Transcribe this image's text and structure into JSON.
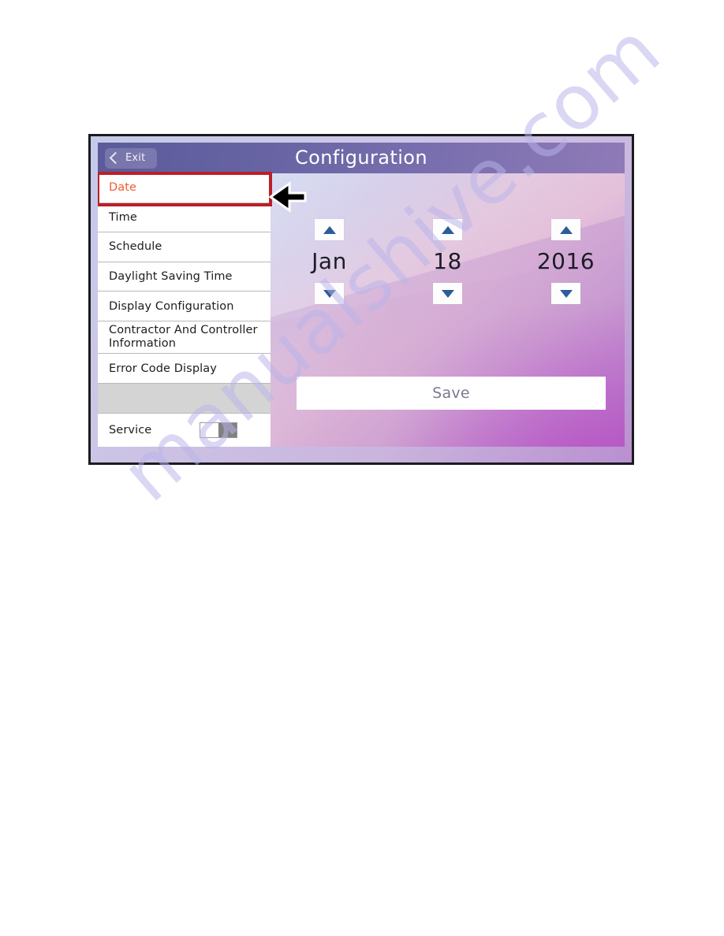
{
  "device_screen": {
    "header": {
      "exit_label": "Exit",
      "back_icon": "chevron-left-icon",
      "title": "Configuration"
    },
    "sidebar": {
      "items": [
        {
          "label": "Date",
          "type": "item",
          "selected": true,
          "lines": 1
        },
        {
          "label": "Time",
          "type": "item",
          "selected": false,
          "lines": 1
        },
        {
          "label": "Schedule",
          "type": "item",
          "selected": false,
          "lines": 1
        },
        {
          "label": "Daylight Saving Time",
          "type": "item",
          "selected": false,
          "lines": 1
        },
        {
          "label": "Display Configuration",
          "type": "item",
          "selected": false,
          "lines": 1
        },
        {
          "label": "Contractor And Controller Information",
          "type": "item",
          "selected": false,
          "lines": 2
        },
        {
          "label": "Error Code Display",
          "type": "item",
          "selected": false,
          "lines": 1
        },
        {
          "label": "",
          "type": "spacer",
          "selected": false,
          "lines": 1
        },
        {
          "label": "Service",
          "type": "toggle",
          "selected": false,
          "lines": 1
        }
      ],
      "service_toggle": {
        "name": "service-toggle",
        "state": "off"
      }
    },
    "content": {
      "date_picker": {
        "fields": [
          {
            "name": "month",
            "value": "Jan",
            "increment_icon": "triangle-up-icon",
            "decrement_icon": "triangle-down-icon"
          },
          {
            "name": "day",
            "value": "18",
            "increment_icon": "triangle-up-icon",
            "decrement_icon": "triangle-down-icon"
          },
          {
            "name": "year",
            "value": "2016",
            "increment_icon": "triangle-up-icon",
            "decrement_icon": "triangle-down-icon"
          }
        ]
      },
      "save_label": "Save"
    }
  },
  "annotations": {
    "pointer_arrow": {
      "name": "pointer-arrow-left",
      "target": "Date"
    },
    "highlight_box": {
      "name": "date-highlight-box",
      "color": "#bb1f28",
      "target": "Date"
    }
  },
  "watermark": {
    "text": "manualshive.com",
    "color": "#b9b4ea"
  },
  "colors": {
    "header_purple": "#6a66a6",
    "selected_item_text": "#f05a32",
    "highlight_red": "#bb1f28",
    "arrow_blue": "#2c5c9c",
    "save_text": "#7b7b8c",
    "toggle_track": "#808080",
    "spacer_gray": "#d4d4d4"
  }
}
